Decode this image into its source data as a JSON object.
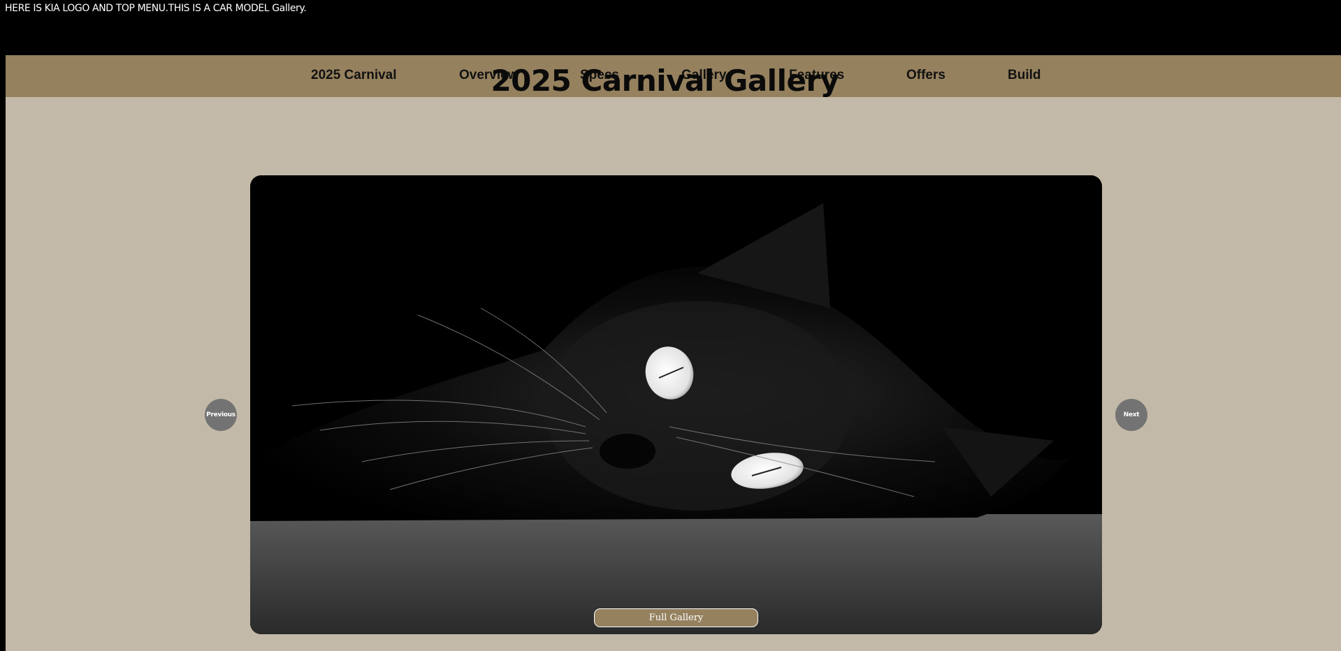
{
  "topbar": {
    "text": "HERE IS KIA LOGO AND TOP MENU.THIS IS A CAR MODEL Gallery."
  },
  "nav": {
    "items": [
      {
        "label": "2025 Carnival"
      },
      {
        "label": "Overview"
      },
      {
        "label": "Specs"
      },
      {
        "label": "Gallery"
      },
      {
        "label": "Features"
      },
      {
        "label": "Offers"
      },
      {
        "label": "Build"
      }
    ]
  },
  "main": {
    "title": "2025 Carnival Gallery",
    "previous_label": "Previous",
    "next_label": "Next",
    "full_gallery_label": "Full Gallery"
  },
  "colors": {
    "nav_background": "#95815e",
    "page_background": "#c3b9a8",
    "button_background": "#737373"
  }
}
